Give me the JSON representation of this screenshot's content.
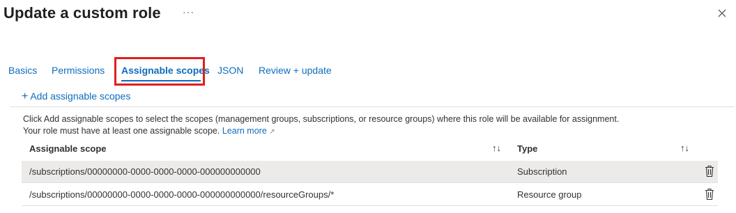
{
  "header": {
    "title": "Update a custom role",
    "more_label": "···"
  },
  "tabs": [
    {
      "label": "Basics",
      "active": false
    },
    {
      "label": "Permissions",
      "active": false
    },
    {
      "label": "Assignable scopes",
      "active": true
    },
    {
      "label": "JSON",
      "active": false
    },
    {
      "label": "Review + update",
      "active": false
    }
  ],
  "toolbar": {
    "add_label": "Add assignable scopes"
  },
  "info": {
    "line1": "Click Add assignable scopes to select the scopes (management groups, subscriptions, or resource groups) where this role will be available for assignment.",
    "line2": "Your role must have at least one assignable scope.",
    "learn_more": "Learn more"
  },
  "table": {
    "columns": [
      "Assignable scope",
      "Type"
    ],
    "rows": [
      {
        "scope": "/subscriptions/00000000-0000-0000-0000-000000000000",
        "type": "Subscription"
      },
      {
        "scope": "/subscriptions/00000000-0000-0000-0000-000000000000/resourceGroups/*",
        "type": "Resource group"
      }
    ]
  },
  "colors": {
    "accent": "#0f6cbd",
    "highlight": "#e01e1e",
    "selected_row": "#edebe9"
  },
  "icons": [
    "more-icon",
    "close-icon",
    "plus-icon",
    "external-link-icon",
    "sort-icon",
    "trash-icon"
  ]
}
